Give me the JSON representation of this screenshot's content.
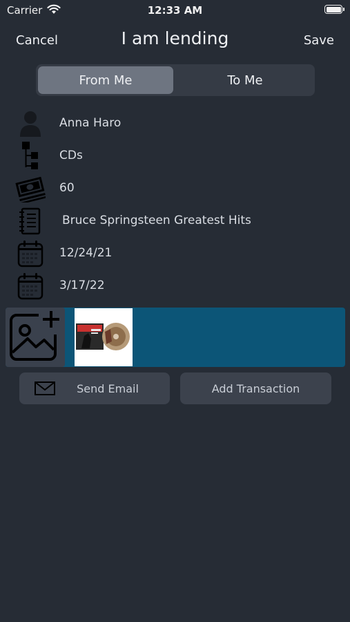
{
  "status": {
    "carrier": "Carrier",
    "time": "12:33 AM"
  },
  "nav": {
    "cancel": "Cancel",
    "title": "I am lending",
    "save": "Save"
  },
  "segment": {
    "from_me": "From Me",
    "to_me": "To Me",
    "selected": "From Me"
  },
  "fields": {
    "person": "Anna Haro",
    "category": "CDs",
    "amount": "60",
    "item": "Bruce Springsteen Greatest Hits",
    "start_date": "12/24/21",
    "due_date": "3/17/22"
  },
  "actions": {
    "send_email": "Send Email",
    "add_transaction": "Add Transaction"
  },
  "icons": {
    "person": "person-icon",
    "category": "hierarchy-icon",
    "amount": "money-icon",
    "item": "notebook-icon",
    "start_date": "calendar-icon",
    "due_date": "calendar-icon",
    "add_photo": "add-photo-icon",
    "email": "envelope-icon"
  },
  "colors": {
    "background": "#262c35",
    "photo_strip": "#0c5577",
    "segment_active": "#6e7581",
    "button": "#3c424d"
  }
}
